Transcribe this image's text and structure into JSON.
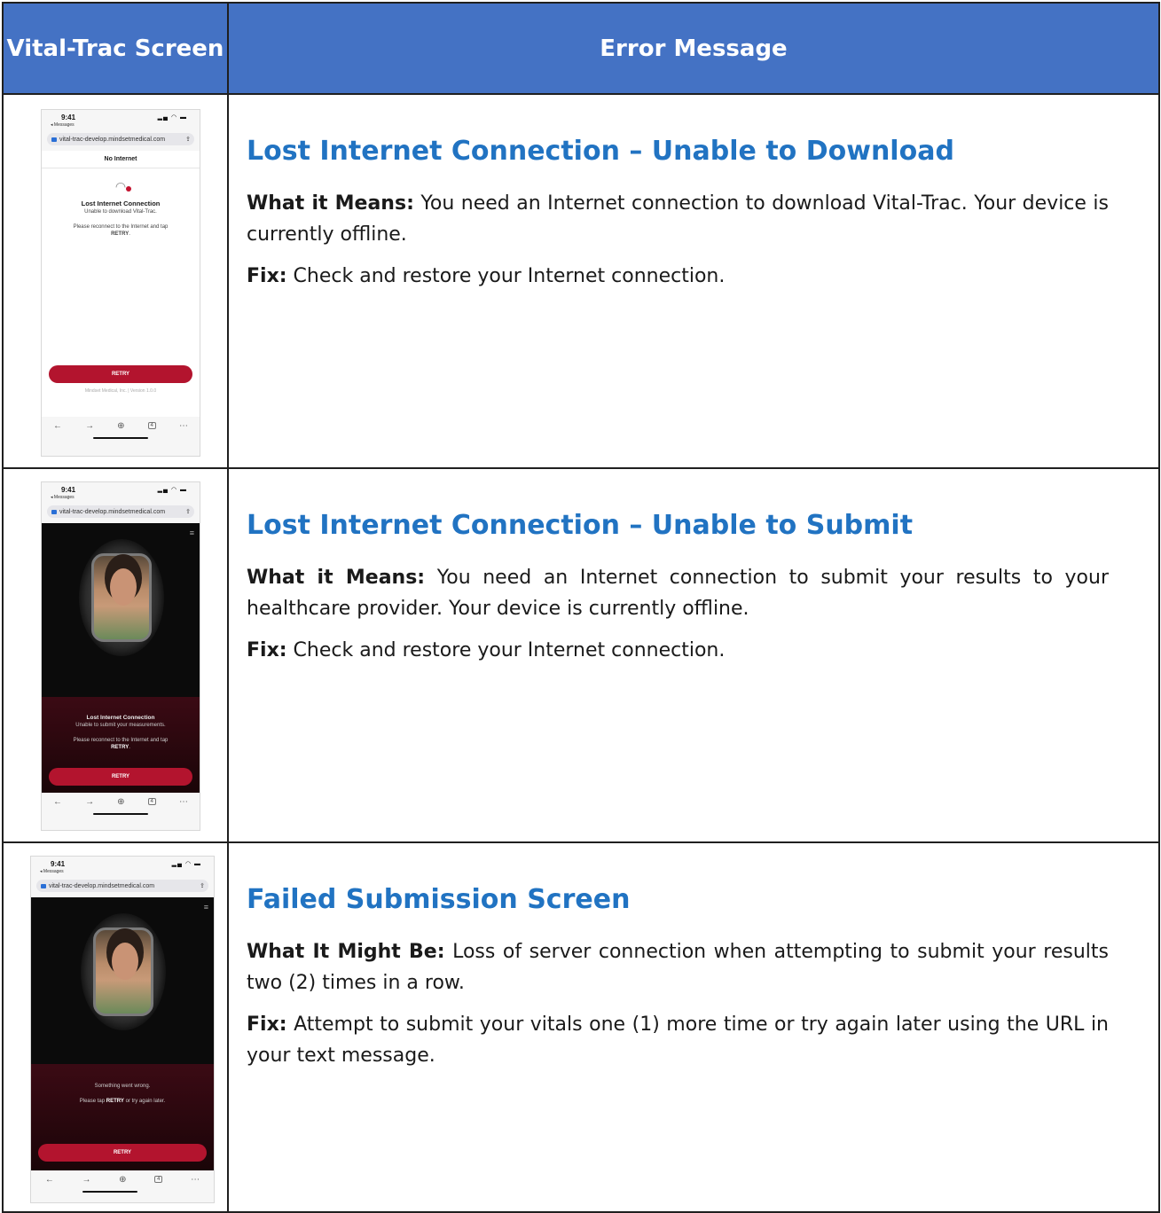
{
  "header": {
    "left": "Vital-Trac Screen",
    "right": "Error Message"
  },
  "rows": [
    {
      "title": "Lost Internet Connection – Unable to Download",
      "p1_label": "What it Means:",
      "p1_text": " You need an Internet connection to download Vital-Trac. Your device is currently offline.",
      "p2_label": "Fix:",
      "p2_text": " Check and restore your Internet connection.",
      "phone": {
        "time": "9:41",
        "back": "◂ Messages",
        "url": "vital-trac-develop.mindsetmedical.com",
        "nav_title": "No Internet",
        "msg_title": "Lost Internet Connection",
        "msg_sub": "Unable to download Vital-Trac.",
        "msg_instr": "Please reconnect to the Internet and tap",
        "msg_instr_bold": "RETRY",
        "retry": "RETRY",
        "version": "Mindset Medical, Inc. | Version 1.0.0",
        "tabs": "4"
      }
    },
    {
      "title": "Lost Internet Connection – Unable to Submit",
      "p1_label": "What it Means:",
      "p1_text": " You need an Internet connection to submit your results to your healthcare provider. Your device is currently offline.",
      "p2_label": "Fix:",
      "p2_text": " Check and restore your Internet connection.",
      "phone": {
        "time": "9:41",
        "back": "◂ Messages",
        "url": "vital-trac-develop.mindsetmedical.com",
        "msg_title": "Lost Internet Connection",
        "msg_sub": "Unable to submit your measurements.",
        "msg_instr": "Please reconnect to the Internet and tap",
        "msg_instr_bold": "RETRY",
        "retry": "RETRY",
        "tabs": "4"
      }
    },
    {
      "title": "Failed Submission Screen",
      "p1_label": "What It Might Be:",
      "p1_text": " Loss of server connection when attempting to submit your results two (2) times in a row.",
      "p2_label": "Fix:",
      "p2_text": " Attempt to submit your vitals one (1) more time or try again later using the URL in your text message.",
      "phone": {
        "time": "9:41",
        "back": "◂ Messages",
        "url": "vital-trac-develop.mindsetmedical.com",
        "msg_sub": "Something went wrong.",
        "msg_instr": "Please tap",
        "msg_instr_bold": "RETRY",
        "msg_instr_tail": "or try again later.",
        "retry": "RETRY",
        "tabs": "4"
      }
    }
  ]
}
